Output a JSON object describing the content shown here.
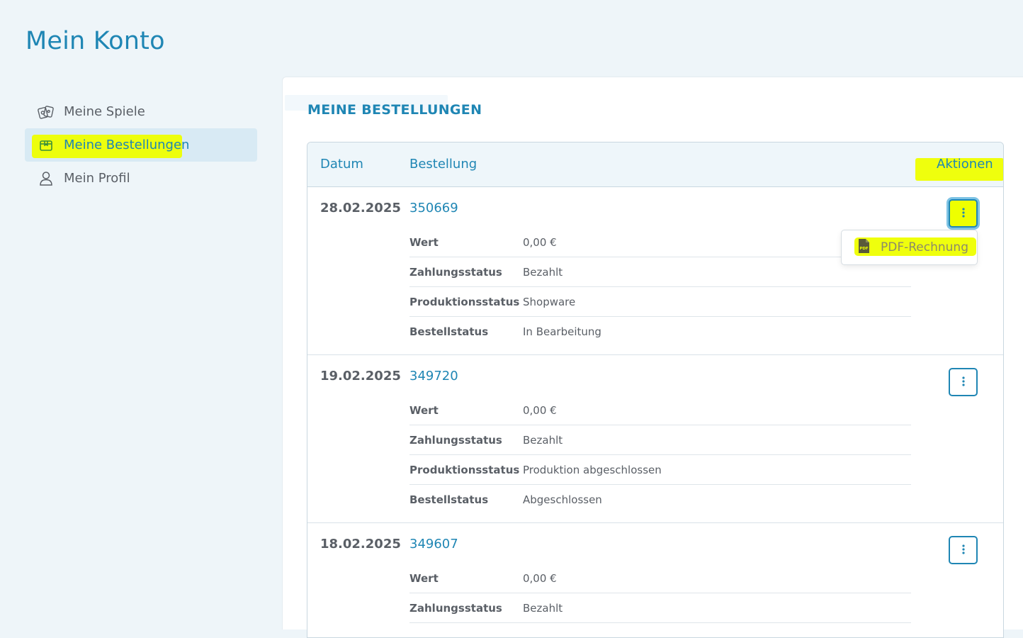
{
  "page": {
    "title": "Mein Konto"
  },
  "sidebar": {
    "items": [
      {
        "label": "Meine Spiele",
        "icon": "game-cards-icon",
        "active": false
      },
      {
        "label": "Meine Bestellungen",
        "icon": "package-icon",
        "active": true
      },
      {
        "label": "Mein Profil",
        "icon": "user-icon",
        "active": false
      }
    ]
  },
  "orders": {
    "title": "MEINE BESTELLUNGEN",
    "headers": {
      "date": "Datum",
      "order": "Bestellung",
      "actions": "Aktionen"
    },
    "rows": [
      {
        "date": "28.02.2025",
        "number": "350669",
        "details": [
          {
            "key": "Wert",
            "value": "0,00 €"
          },
          {
            "key": "Zahlungsstatus",
            "value": "Bezahlt"
          },
          {
            "key": "Produktionsstatus",
            "value": "Shopware"
          },
          {
            "key": "Bestellstatus",
            "value": "In Bearbeitung"
          }
        ]
      },
      {
        "date": "19.02.2025",
        "number": "349720",
        "details": [
          {
            "key": "Wert",
            "value": "0,00 €"
          },
          {
            "key": "Zahlungsstatus",
            "value": "Bezahlt"
          },
          {
            "key": "Produktionsstatus",
            "value": "Produktion abgeschlossen"
          },
          {
            "key": "Bestellstatus",
            "value": "Abgeschlossen"
          }
        ]
      },
      {
        "date": "18.02.2025",
        "number": "349607",
        "details": [
          {
            "key": "Wert",
            "value": "0,00 €"
          },
          {
            "key": "Zahlungsstatus",
            "value": "Bezahlt"
          }
        ]
      }
    ],
    "dropdown": {
      "item_label": "PDF-Rechnung",
      "icon": "pdf-file-icon"
    }
  },
  "colors": {
    "accent": "#1f86b4",
    "highlight": "#eeff00",
    "active_bg": "#d8eaf4"
  }
}
